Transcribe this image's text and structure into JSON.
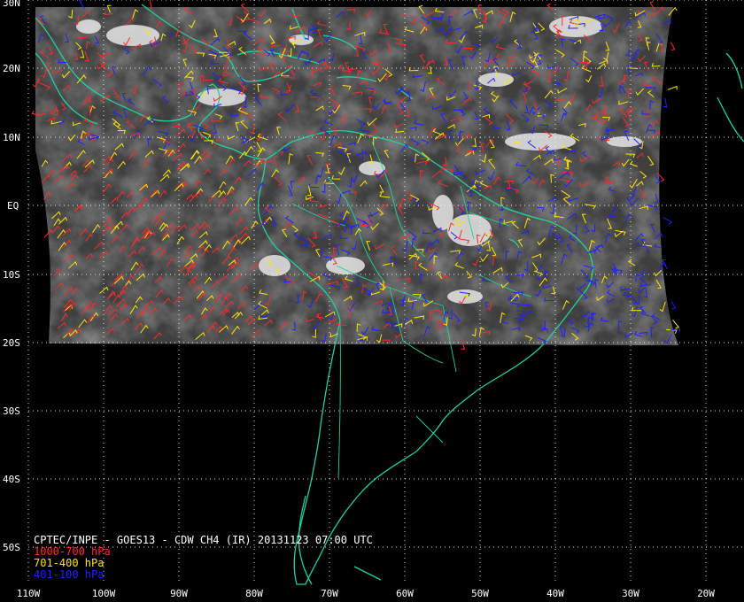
{
  "title": "CPTEC/INPE - GOES13 - CDW CH4 (IR) 20131123 07:00 UTC",
  "legend": [
    {
      "label": "1000-700 hPa",
      "color": "#ff2a2a"
    },
    {
      "label": "701-400 hPa",
      "color": "#ffe600"
    },
    {
      "label": "401-100 hPa",
      "color": "#2020ff"
    }
  ],
  "lat_labels": [
    "30N",
    "20N",
    "10N",
    "EQ",
    "10S",
    "20S",
    "30S",
    "40S",
    "50S"
  ],
  "lon_labels": [
    "110W",
    "100W",
    "90W",
    "80W",
    "70W",
    "60W",
    "50W",
    "40W",
    "30W",
    "20W"
  ],
  "colors": {
    "background": "#000000",
    "coastline": "#22d1a0",
    "grid": "#ffffff",
    "satellite_image": "#6a6a6a"
  }
}
